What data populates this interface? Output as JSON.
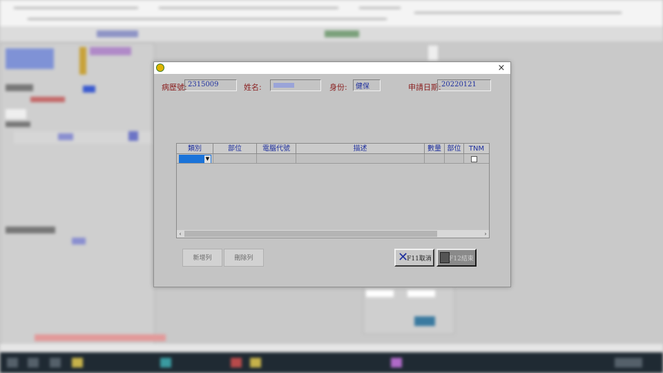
{
  "dialog": {
    "close_glyph": "×",
    "icon": "app-icon"
  },
  "header": {
    "chart_no_label": "病歷號:",
    "chart_no_value": "2315009",
    "name_label": "姓名:",
    "identity_label": "身份:",
    "identity_value": "健保",
    "date_label": "申請日期:",
    "date_value": "20220121"
  },
  "grid": {
    "columns": [
      "類別",
      "部位",
      "電腦代號",
      "描述",
      "數量",
      "部位",
      "TNM"
    ],
    "scroll_left": "‹",
    "scroll_right": "›"
  },
  "buttons": {
    "add_row": "新增列",
    "delete_row": "刪除列",
    "cancel": "F11取消",
    "finish": "F12結束"
  },
  "colors": {
    "label": "#8a1f1f",
    "value": "#1e2f9e",
    "selection": "#1a73d9"
  }
}
